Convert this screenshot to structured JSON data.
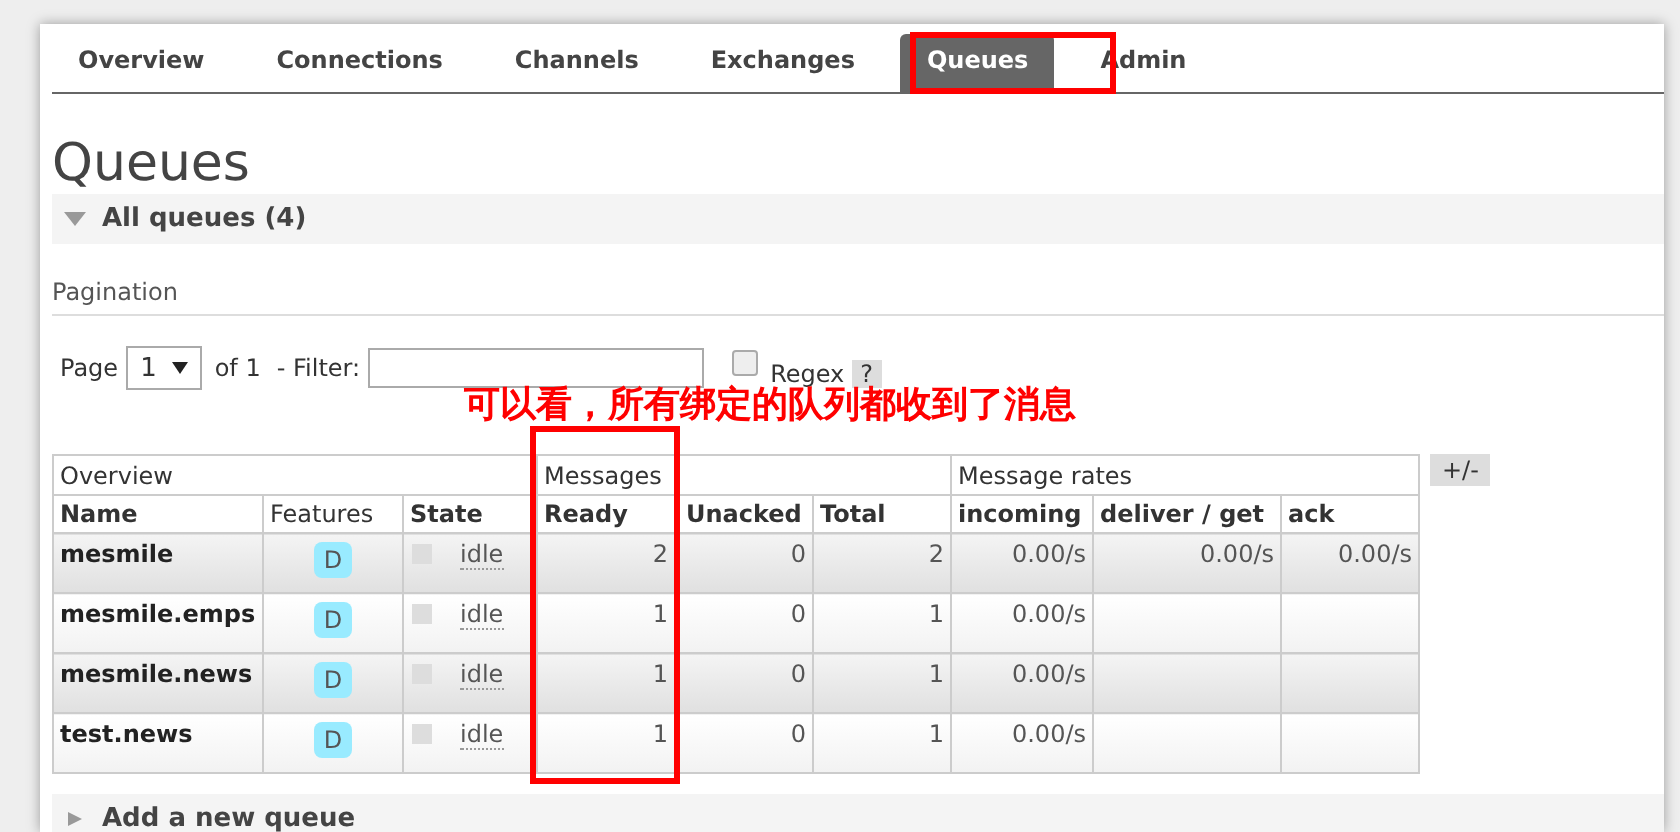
{
  "tabs": [
    {
      "label": "Overview",
      "selected": false
    },
    {
      "label": "Connections",
      "selected": false
    },
    {
      "label": "Channels",
      "selected": false
    },
    {
      "label": "Exchanges",
      "selected": false
    },
    {
      "label": "Queues",
      "selected": true
    },
    {
      "label": "Admin",
      "selected": false
    }
  ],
  "title": "Queues",
  "section": {
    "label": "All queues (4)",
    "expanded": true
  },
  "pagination": {
    "heading": "Pagination",
    "page_label": "Page",
    "page": "1",
    "of_label": "of 1",
    "filter_label": "- Filter:",
    "regex_label": "Regex",
    "regex_checked": false,
    "help": "?"
  },
  "annotation": "可以看，所有绑定的队列都收到了消息",
  "table": {
    "groups": [
      {
        "label": "Overview",
        "columns": [
          {
            "label": "Name",
            "kind": "sortable"
          },
          {
            "label": "Features",
            "kind": "plain"
          },
          {
            "label": "State",
            "kind": "sortable"
          }
        ]
      },
      {
        "label": "Messages",
        "columns": [
          {
            "label": "Ready",
            "kind": "sortable"
          },
          {
            "label": "Unacked",
            "kind": "sortable"
          },
          {
            "label": "Total",
            "kind": "sortable"
          }
        ]
      },
      {
        "label": "Message rates",
        "columns": [
          {
            "label": "incoming",
            "kind": "sortable"
          },
          {
            "label": "deliver / get",
            "kind": "sortable"
          },
          {
            "label": "ack",
            "kind": "sortable"
          }
        ]
      }
    ],
    "rows": [
      {
        "name": "mesmile",
        "features": [
          "D"
        ],
        "state": "idle",
        "ready": "2",
        "unacked": "0",
        "total": "2",
        "incoming": "0.00/s",
        "deliver_get": "0.00/s",
        "ack": "0.00/s"
      },
      {
        "name": "mesmile.emps",
        "features": [
          "D"
        ],
        "state": "idle",
        "ready": "1",
        "unacked": "0",
        "total": "1",
        "incoming": "0.00/s"
      },
      {
        "name": "mesmile.news",
        "features": [
          "D"
        ],
        "state": "idle",
        "ready": "1",
        "unacked": "0",
        "total": "1",
        "incoming": "0.00/s"
      },
      {
        "name": "test.news",
        "features": [
          "D"
        ],
        "state": "idle",
        "ready": "1",
        "unacked": "0",
        "total": "1",
        "incoming": "0.00/s"
      }
    ],
    "toggle": "+/-"
  },
  "next_section": {
    "label": "Add a new queue"
  }
}
